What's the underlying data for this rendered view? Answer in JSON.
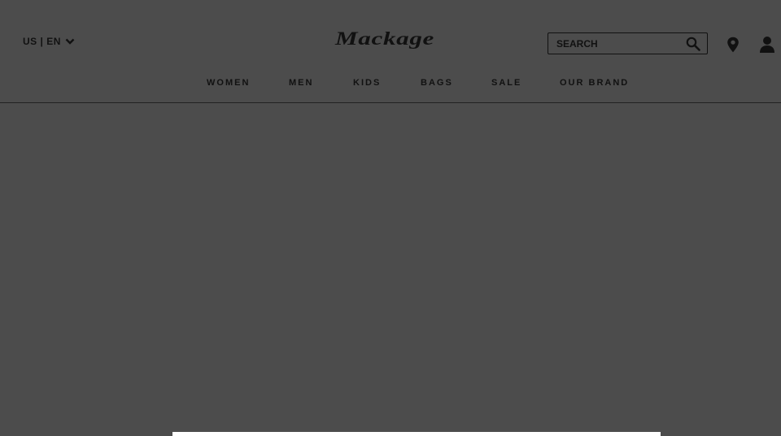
{
  "header": {
    "locale_label": "US | EN",
    "logo_text": "Mackage",
    "search": {
      "placeholder": "SEARCH"
    },
    "icons": {
      "locale_chevron": "chevron-down-icon",
      "search": "search-icon",
      "store_locator": "map-pin-icon",
      "account": "user-icon"
    }
  },
  "nav": {
    "items": [
      {
        "label": "WOMEN"
      },
      {
        "label": "MEN"
      },
      {
        "label": "KIDS"
      },
      {
        "label": "BAGS"
      },
      {
        "label": "SALE"
      },
      {
        "label": "OUR BRAND"
      }
    ]
  },
  "colors": {
    "overlay_background": "#4c4c4c",
    "text": "#111111",
    "panel": "#ffffff"
  }
}
